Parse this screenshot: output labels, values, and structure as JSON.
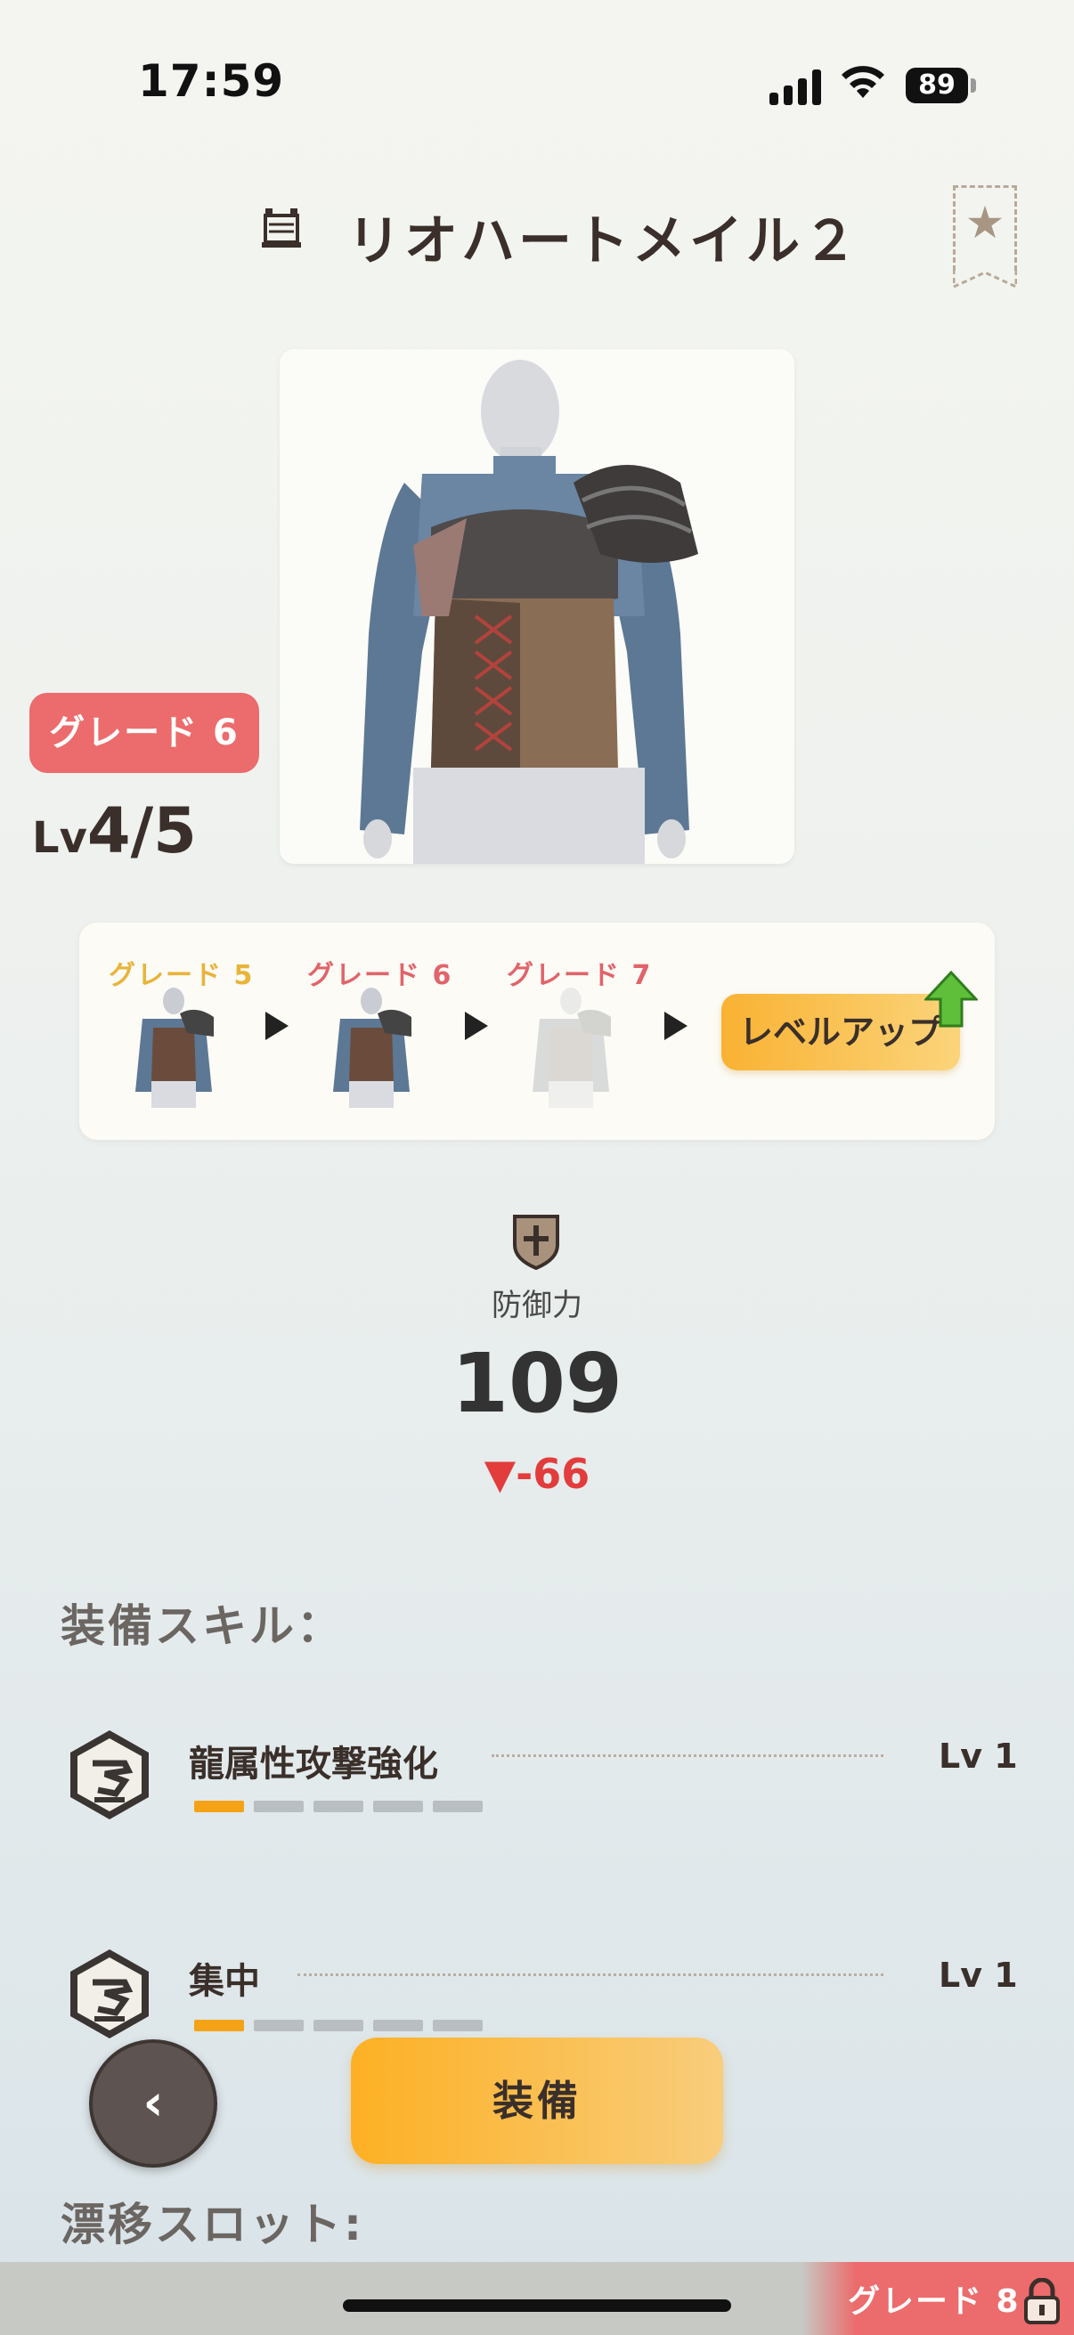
{
  "status_bar": {
    "time": "17:59",
    "battery": "89"
  },
  "header": {
    "title": "リオハートメイル２"
  },
  "item": {
    "grade_badge": "グレード 6",
    "level_prefix": "Lv",
    "level_value": "4/5"
  },
  "grade_progression": {
    "steps": [
      {
        "label": "グレード 5",
        "color": "#e8b43a"
      },
      {
        "label": "グレード 6",
        "color": "#e0646a"
      },
      {
        "label": "グレード 7",
        "color": "#e0646a"
      }
    ],
    "level_up_label": "レベルアップ"
  },
  "stats": {
    "defense_label": "防御力",
    "defense_value": "109",
    "defense_diff": "▼-66"
  },
  "skills_section": {
    "title": "装備スキル：",
    "skills": [
      {
        "name": "龍属性攻撃強化",
        "level": "Lv 1",
        "progress": 1,
        "max": 5
      },
      {
        "name": "集中",
        "level": "Lv 1",
        "progress": 1,
        "max": 5
      }
    ]
  },
  "slot_section": {
    "title": "漂移スロット:"
  },
  "buttons": {
    "back": "‹",
    "equip": "装備"
  },
  "next_grade": {
    "label": "グレード 8"
  }
}
